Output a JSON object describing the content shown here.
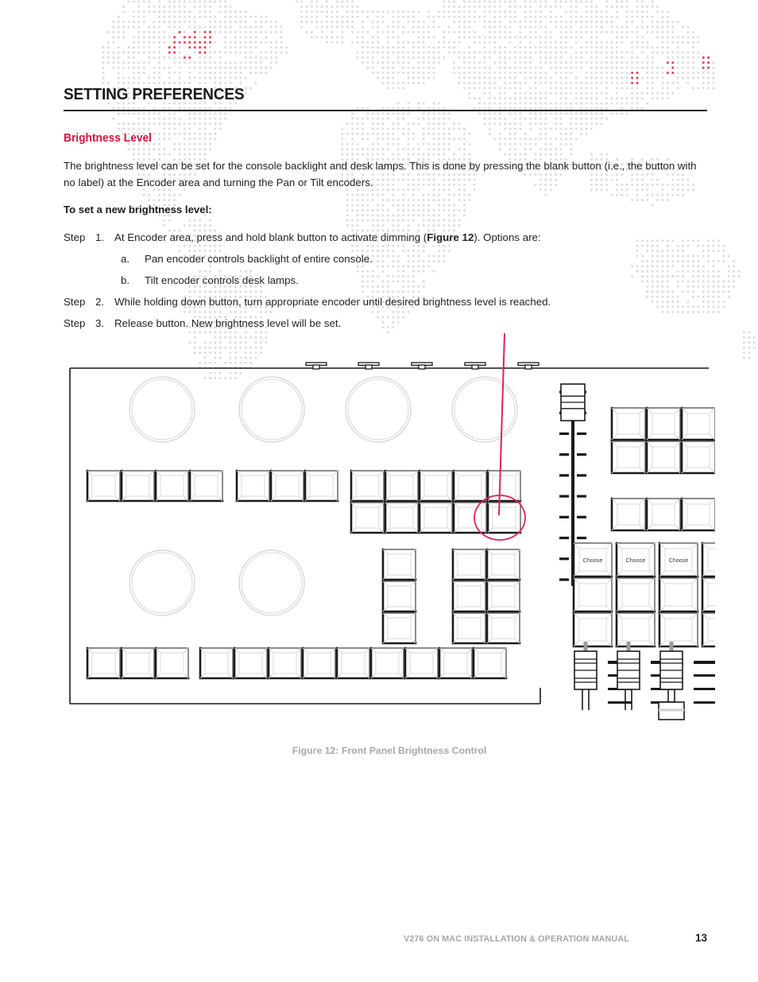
{
  "document": {
    "section_title": "SETTING PREFERENCES",
    "sub_title": "Brightness Level",
    "intro_paragraph": "The brightness level can be set for the console backlight and desk lamps. This is done by pressing the blank button (i.e., the button with no label) at the Encoder area and turning the Pan or Tilt encoders.",
    "lead_in": "To set a new brightness level:"
  },
  "steps": [
    {
      "word": "Step",
      "number": "1.",
      "text_before": "At Encoder area, press and hold blank button to activate dimming (",
      "bold": "Figure 12",
      "text_after": "). Options are:"
    },
    {
      "word": "Step",
      "number": "2.",
      "text": "While holding down button, turn appropriate encoder until desired brightness level is reached."
    },
    {
      "word": "Step",
      "number": "3.",
      "text": "Release button. New brightness level will be set."
    }
  ],
  "substeps": [
    {
      "letter": "a.",
      "text": "Pan encoder controls backlight of entire console."
    },
    {
      "letter": "b.",
      "text": "Tilt encoder controls desk lamps."
    }
  ],
  "figure": {
    "caption": "Figure 12:  Front Panel Brightness Control",
    "callout_label": "blank-button-highlight",
    "key_button_label": "Choose",
    "choose_labels": [
      "Choose",
      "Choose",
      "Choose"
    ]
  },
  "footer": {
    "manual_title": "V276 ON MAC INSTALLATION & OPERATION MANUAL",
    "page_number": "13"
  },
  "colors": {
    "accent_red": "#d3123f",
    "highlight_crimson": "#e0205c",
    "text": "#231f20",
    "muted": "#a7a7a9",
    "rule": "#2b2b2b",
    "watermark_dot": "#dcdcdc",
    "watermark_dot_accent": "#e8384f",
    "panel_line": "#1a1a1a",
    "panel_bevel": "#d8d8d8"
  }
}
